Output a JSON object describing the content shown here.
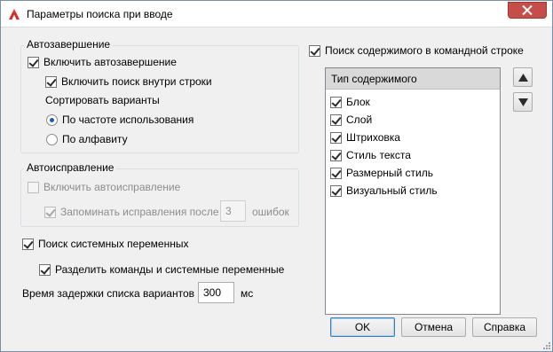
{
  "window": {
    "title": "Параметры поиска при вводе"
  },
  "autocomplete": {
    "group_label": "Автозавершение",
    "enable_label": "Включить автозавершение",
    "enable_checked": true,
    "search_in_string_label": "Включить поиск внутри строки",
    "search_in_string_checked": true,
    "sort_label": "Сортировать варианты",
    "sort_options": [
      {
        "label": "По частоте использования",
        "selected": true
      },
      {
        "label": "По алфавиту",
        "selected": false
      }
    ]
  },
  "autocorrect": {
    "group_label": "Автоисправление",
    "enable_label": "Включить автоисправление",
    "enable_checked": false,
    "remember_label": "Запоминать исправления после",
    "remember_checked": true,
    "errors_value": "3",
    "errors_suffix": "ошибок"
  },
  "system_vars": {
    "search_label": "Поиск системных переменных",
    "search_checked": true,
    "separate_label": "Разделить команды и системные переменные",
    "separate_checked": true
  },
  "delay": {
    "label": "Время задержки списка вариантов",
    "value": "300",
    "unit": "мс"
  },
  "content_search": {
    "label": "Поиск содержимого в командной строке",
    "checked": true,
    "list_header": "Тип содержимого",
    "items": [
      {
        "label": "Блок",
        "checked": true
      },
      {
        "label": "Слой",
        "checked": true
      },
      {
        "label": "Штриховка",
        "checked": true
      },
      {
        "label": "Стиль текста",
        "checked": true
      },
      {
        "label": "Размерный стиль",
        "checked": true
      },
      {
        "label": "Визуальный стиль",
        "checked": true
      }
    ]
  },
  "buttons": {
    "ok": "OK",
    "cancel": "Отмена",
    "help": "Справка"
  },
  "colors": {
    "app_icon": "#d62a2a",
    "close_button": "#c74e48",
    "radio_dot": "#1c5bb5"
  },
  "icons": {
    "app": "autocad-logo-icon",
    "close": "close-icon",
    "up": "triangle-up-icon",
    "down": "triangle-down-icon"
  }
}
